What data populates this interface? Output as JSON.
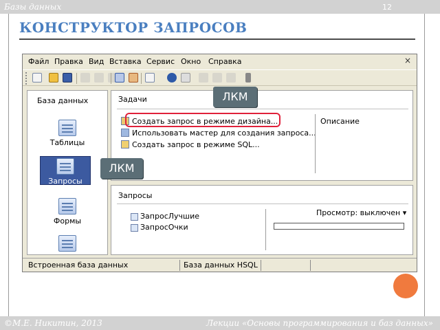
{
  "slide": {
    "section": "Базы данных",
    "number": "12",
    "title": "КОНСТРУКТОР ЗАПРОСОВ",
    "footer_left": "©М.Е. Никитин, 2013",
    "footer_right": "Лекции «Основы программирования и баз данных»"
  },
  "window": {
    "menu": [
      "Файл",
      "Правка",
      "Вид",
      "Вставка",
      "Сервис",
      "Окно",
      "Справка"
    ],
    "close": "×",
    "toolbar_icons": [
      "new-doc-icon",
      "open-folder-icon",
      "save-icon",
      "cut-icon",
      "copy-icon",
      "paste-icon",
      "sort-asc-icon",
      "sort-desc-icon",
      "form-icon",
      "help-icon",
      "tb-extra-icon",
      "tb-extra2-icon",
      "tb-extra3-icon",
      "tb-extra4-icon"
    ],
    "left_pane": {
      "header": "База данных",
      "items": [
        {
          "label": "Таблицы",
          "icon": "tables-icon",
          "selected": false
        },
        {
          "label": "Запросы",
          "icon": "queries-icon",
          "selected": true
        },
        {
          "label": "Формы",
          "icon": "forms-icon",
          "selected": false
        }
      ]
    },
    "tasks": {
      "header": "Задачи",
      "items": [
        "Создать запрос в режиме дизайна...",
        "Использовать мастер для создания запроса...",
        "Создать запрос в режиме SQL..."
      ],
      "description_header": "Описание"
    },
    "queries": {
      "header": "Запросы",
      "items": [
        "ЗапросЛучшие",
        "ЗапросОчки"
      ],
      "preview": "Просмотр: выключен ▾"
    },
    "status": [
      "Встроенная база данных",
      "База данных HSQL"
    ]
  },
  "callouts": [
    "ЛКМ",
    "ЛКМ"
  ],
  "colors": {
    "title": "#4a7fc0",
    "highlight": "#e0203a",
    "callout": "#5b6e76",
    "accent_circle": "#f07a3e"
  }
}
